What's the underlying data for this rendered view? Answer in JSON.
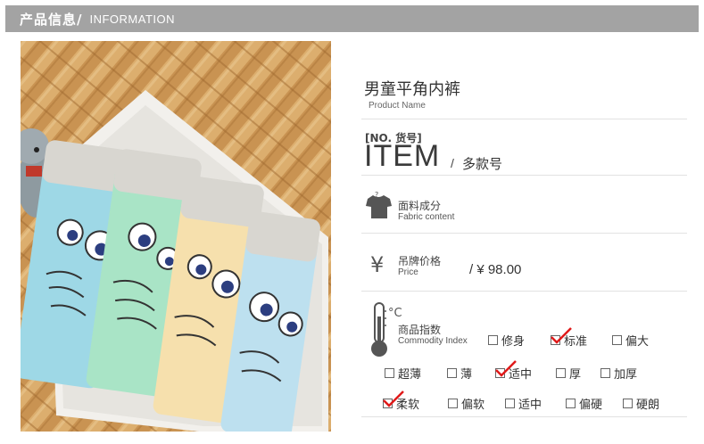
{
  "header": {
    "title_cn": "产品信息/",
    "title_en": "INFORMATION"
  },
  "product": {
    "name_cn": "男童平角内裤",
    "name_en": "Product Name"
  },
  "item": {
    "no_label": "[NO. 货号]",
    "big_label": "ITEM",
    "separator": "/",
    "value": "多款号"
  },
  "fabric": {
    "label_cn": "面料成分",
    "label_en": "Fabric content",
    "icon": "tshirt-icon"
  },
  "price": {
    "icon": "yen-icon",
    "label_cn": "吊牌价格",
    "label_en": "Price",
    "value": "/ ¥ 98.00"
  },
  "index": {
    "icon": "thermometer-icon",
    "label_cn": "商品指数",
    "label_en": "Commodity Index",
    "fit": [
      {
        "label": "修身",
        "checked": false
      },
      {
        "label": "标准",
        "checked": true
      },
      {
        "label": "偏大",
        "checked": false
      }
    ],
    "thickness": [
      {
        "label": "超薄",
        "checked": false
      },
      {
        "label": "薄",
        "checked": false
      },
      {
        "label": "适中",
        "checked": true
      },
      {
        "label": "厚",
        "checked": false
      },
      {
        "label": "加厚",
        "checked": false
      }
    ],
    "softness": [
      {
        "label": "柔软",
        "checked": true
      },
      {
        "label": "偏软",
        "checked": false
      },
      {
        "label": "适中",
        "checked": false
      },
      {
        "label": "偏硬",
        "checked": false
      },
      {
        "label": "硬朗",
        "checked": false
      }
    ]
  },
  "colors": {
    "header_bg": "#a3a3a3",
    "check": "#e01a1a",
    "divider": "#e2e2e2"
  }
}
